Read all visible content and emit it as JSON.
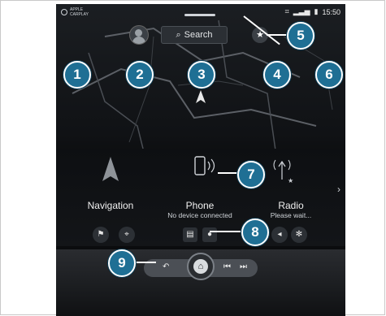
{
  "status": {
    "time": "15:50",
    "signal_icon": "signal-bars-icon",
    "bluetooth_icon": "bluetooth-icon",
    "battery_icon": "battery-icon"
  },
  "carplay": {
    "line1": "APPLE",
    "line2": "CARPLAY"
  },
  "header": {
    "search_label": "Search"
  },
  "tiles": {
    "navigation": {
      "label": "Navigation"
    },
    "phone": {
      "label": "Phone",
      "status": "No device connected"
    },
    "radio": {
      "label": "Radio",
      "status": "Please wait..."
    }
  },
  "callouts": [
    "1",
    "2",
    "3",
    "4",
    "5",
    "6",
    "7",
    "8",
    "9"
  ],
  "colors": {
    "callout_fill": "#1f6f94",
    "screen_bg": "#0b0c0e"
  }
}
